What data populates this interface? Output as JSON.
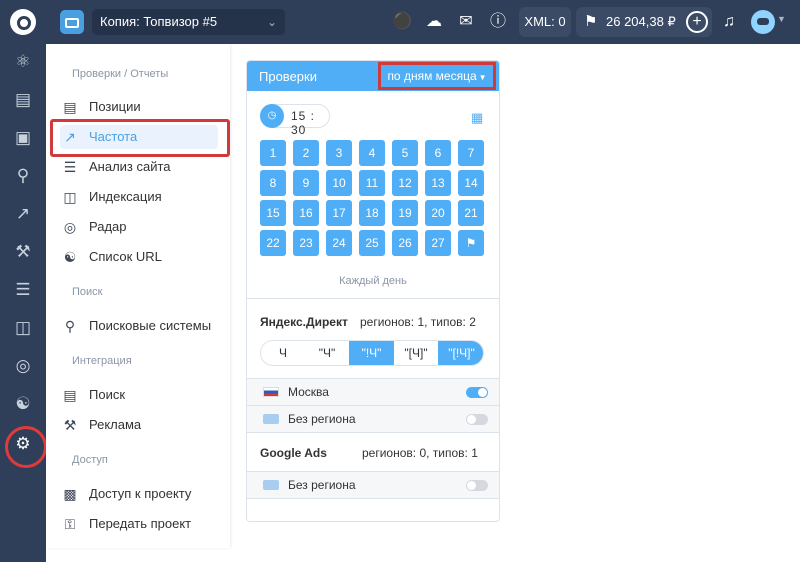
{
  "header": {
    "project_name": "Копия: Топвизор #5",
    "xml_label": "XML: 0",
    "balance": "26 204,38 ₽"
  },
  "sidemenu": {
    "groups": [
      {
        "label": "Проверки / Отчеты"
      },
      {
        "label": "Поиск"
      },
      {
        "label": "Интеграция"
      },
      {
        "label": "Доступ"
      }
    ],
    "items": [
      {
        "label": "Позиции",
        "icon": "bar-chart-icon"
      },
      {
        "label": "Частота",
        "icon": "trend-line-icon"
      },
      {
        "label": "Анализ сайта",
        "icon": "site-analysis-icon"
      },
      {
        "label": "Индексация",
        "icon": "inbox-icon"
      },
      {
        "label": "Радар",
        "icon": "radar-icon"
      },
      {
        "label": "Список URL",
        "icon": "sitemap-icon"
      },
      {
        "label": "Поисковые системы",
        "icon": "map-pin-icon"
      },
      {
        "label": "Поиск",
        "icon": "bar-chart-icon"
      },
      {
        "label": "Реклама",
        "icon": "megaphone-icon"
      },
      {
        "label": "Доступ к проекту",
        "icon": "lock-icon"
      },
      {
        "label": "Передать проект",
        "icon": "key-icon"
      }
    ]
  },
  "panel": {
    "title": "Проверки",
    "mode_label": "по дням месяца",
    "time": "15 : 30",
    "days": [
      "1",
      "2",
      "3",
      "4",
      "5",
      "6",
      "7",
      "8",
      "9",
      "10",
      "11",
      "12",
      "13",
      "14",
      "15",
      "16",
      "17",
      "18",
      "19",
      "20",
      "21",
      "22",
      "23",
      "24",
      "25",
      "26",
      "27"
    ],
    "last_day_glyph": "⚑",
    "every_day_label": "Каждый день",
    "yandex": {
      "title": "Яндекс.Директ",
      "meta": "регионов: 1,   типов: 2",
      "match_types": [
        "Ч",
        "\"Ч\"",
        "\"!Ч\"",
        "\"[Ч]\"",
        "\"[!Ч]\""
      ],
      "regions": [
        {
          "name": "Москва",
          "enabled": true
        },
        {
          "name": "Без региона",
          "enabled": false
        }
      ]
    },
    "google": {
      "title": "Google Ads",
      "meta": "регионов: 0,   типов: 1",
      "regions": [
        {
          "name": "Без региона",
          "enabled": false
        }
      ]
    }
  },
  "colors": {
    "topbar": "#2f3f59",
    "accent": "#4faef5",
    "highlight": "#d03a3a"
  }
}
